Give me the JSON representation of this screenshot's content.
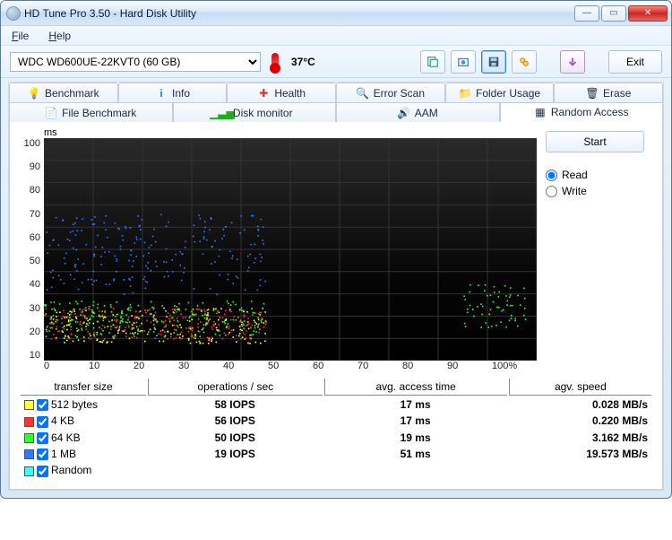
{
  "window": {
    "title": "HD Tune Pro 3.50 - Hard Disk Utility"
  },
  "menu": {
    "file": "File",
    "help": "Help"
  },
  "toolbar": {
    "drive": "WDC WD600UE-22KVT0 (60 GB)",
    "temp": "37°C",
    "exit": "Exit"
  },
  "tabs": {
    "row1": [
      "Benchmark",
      "Info",
      "Health",
      "Error Scan",
      "Folder Usage",
      "Erase"
    ],
    "row2": [
      "File Benchmark",
      "Disk monitor",
      "AAM",
      "Random Access"
    ]
  },
  "panel": {
    "ylabel": "ms",
    "start": "Start",
    "read": "Read",
    "write": "Write"
  },
  "chart_data": {
    "type": "scatter",
    "xlabel": "%",
    "ylabel": "ms",
    "xlim": [
      0,
      100
    ],
    "ylim": [
      0,
      100
    ],
    "xticks": [
      0,
      10,
      20,
      30,
      40,
      50,
      60,
      70,
      80,
      90,
      100
    ],
    "yticks": [
      10,
      20,
      30,
      40,
      50,
      60,
      70,
      80,
      90,
      100
    ],
    "series": [
      {
        "name": "512 bytes",
        "color": "#ffff33",
        "x_range": [
          0,
          45
        ],
        "y_center": 16,
        "y_spread": 8,
        "avg_ms": 17
      },
      {
        "name": "4 KB",
        "color": "#ff3333",
        "x_range": [
          0,
          45
        ],
        "y_center": 17,
        "y_spread": 7,
        "avg_ms": 17
      },
      {
        "name": "64 KB",
        "color": "#33ff33",
        "x_range": [
          0,
          45
        ],
        "y_center": 19,
        "y_spread": 8,
        "avg_ms": 19,
        "extra_cluster": {
          "x_range": [
            85,
            98
          ],
          "y_center": 25,
          "y_spread": 10
        }
      },
      {
        "name": "1 MB",
        "color": "#3377ff",
        "x_range": [
          0,
          45
        ],
        "y_center": 48,
        "y_spread": 18,
        "avg_ms": 51
      },
      {
        "name": "Random",
        "color": "#33ffff",
        "x_range": [
          0,
          0
        ],
        "y_center": 0,
        "y_spread": 0
      }
    ]
  },
  "results": {
    "headers": [
      "transfer size",
      "operations / sec",
      "avg. access time",
      "agv. speed"
    ],
    "rows": [
      {
        "color": "#ffff33",
        "checked": true,
        "size": "512 bytes",
        "ops": "58 IOPS",
        "acc": "17 ms",
        "spd": "0.028 MB/s"
      },
      {
        "color": "#ff3333",
        "checked": true,
        "size": "4 KB",
        "ops": "56 IOPS",
        "acc": "17 ms",
        "spd": "0.220 MB/s"
      },
      {
        "color": "#33ff33",
        "checked": true,
        "size": "64 KB",
        "ops": "50 IOPS",
        "acc": "19 ms",
        "spd": "3.162 MB/s"
      },
      {
        "color": "#3377ff",
        "checked": true,
        "size": "1 MB",
        "ops": "19 IOPS",
        "acc": "51 ms",
        "spd": "19.573 MB/s"
      },
      {
        "color": "#33ffff",
        "checked": true,
        "size": "Random",
        "ops": "",
        "acc": "",
        "spd": ""
      }
    ]
  }
}
